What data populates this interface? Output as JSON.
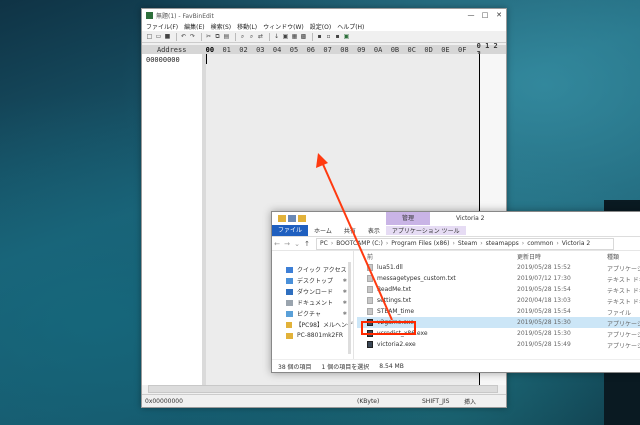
{
  "editor": {
    "title": "無題(1) - FavBinEdit",
    "window_controls": [
      "—",
      "□",
      "✕"
    ],
    "menu": [
      "ファイル(F)",
      "編集(E)",
      "検索(S)",
      "移動(L)",
      "ウィンドウ(W)",
      "設定(O)",
      "ヘルプ(H)"
    ],
    "header": {
      "address_label": "Address",
      "columns": [
        "00",
        "01",
        "02",
        "03",
        "04",
        "05",
        "06",
        "07",
        "08",
        "09",
        "0A",
        "0B",
        "0C",
        "0D",
        "0E",
        "0F"
      ],
      "ascii_label": "0 1 2 3"
    },
    "first_address": "00000000",
    "status": {
      "offset": "0x00000000",
      "unit": "(KByte)",
      "keys": "SHIFT_JIS",
      "mode": "挿入"
    }
  },
  "explorer": {
    "manage_tab": "管理",
    "window_title": "Victoria 2",
    "ribbon_tabs": [
      "ファイル",
      "ホーム",
      "共有",
      "表示",
      "アプリケーション ツール"
    ],
    "breadcrumb": [
      "PC",
      "BOOTCAMP (C:)",
      "Program Files (x86)",
      "Steam",
      "steamapps",
      "common",
      "Victoria 2"
    ],
    "nav_items": [
      {
        "label": "クイック アクセス",
        "color": "#3d7fd6",
        "pinned": false
      },
      {
        "label": "デスクトップ",
        "color": "#4a90d9",
        "pinned": true
      },
      {
        "label": "ダウンロード",
        "color": "#2f6fbf",
        "pinned": true
      },
      {
        "label": "ドキュメント",
        "color": "#9aa4ae",
        "pinned": true
      },
      {
        "label": "ピクチャ",
        "color": "#5aa0d8",
        "pinned": true
      },
      {
        "label": "【PC98】メルヘンゲ",
        "color": "#e2b23a",
        "pinned": false
      },
      {
        "label": "PC-8801mk2FR",
        "color": "#e2b23a",
        "pinned": false
      }
    ],
    "columns": {
      "name": "前",
      "date": "更新日時",
      "type": "種類"
    },
    "files": [
      {
        "name": "lua51.dll",
        "date": "2019/05/28 15:52",
        "type": "アプリケーション拡張"
      },
      {
        "name": "messagetypes_custom.txt",
        "date": "2019/07/12 17:30",
        "type": "テキスト ドキュメント"
      },
      {
        "name": "ReadMe.txt",
        "date": "2019/05/28 15:54",
        "type": "テキスト ドキュメント"
      },
      {
        "name": "settings.txt",
        "date": "2020/04/18 13:03",
        "type": "テキスト ドキュメント"
      },
      {
        "name": "STEAM_time",
        "date": "2019/05/28 15:54",
        "type": "ファイル"
      },
      {
        "name": "v2game.exe",
        "date": "2019/05/28 15:30",
        "type": "アプリケーション"
      },
      {
        "name": "vcredist_x86.exe",
        "date": "2019/05/28 15:30",
        "type": "アプリケーション"
      },
      {
        "name": "victoria2.exe",
        "date": "2019/05/28 15:49",
        "type": "アプリケーション"
      }
    ],
    "status": {
      "count": "38 個の項目",
      "selected": "1 個の項目を選択",
      "size": "8.54 MB"
    }
  },
  "colors": {
    "highlight": "#ff2a00",
    "file_tab": "#1f5fbf",
    "manage_tab": "#c9b4e6"
  }
}
